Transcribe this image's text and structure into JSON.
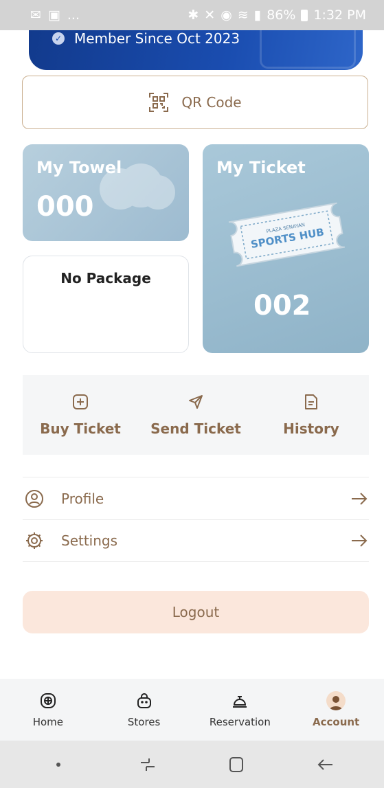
{
  "status_bar": {
    "battery": "86%",
    "time": "1:32 PM",
    "notif_overflow": "..."
  },
  "member_card": {
    "member_since": "Member Since Oct 2023"
  },
  "qr": {
    "label": "QR Code"
  },
  "towel": {
    "title": "My Towel",
    "count": "000"
  },
  "ticket": {
    "title": "My Ticket",
    "count": "002",
    "art_brand_small": "PLAZA SENAYAN",
    "art_brand": "SPORTS HUB"
  },
  "package": {
    "label": "No Package"
  },
  "actions": [
    {
      "label": "Buy Ticket",
      "icon": "plus-square-icon"
    },
    {
      "label": "Send Ticket",
      "icon": "send-icon"
    },
    {
      "label": "History",
      "icon": "document-icon"
    }
  ],
  "menu": [
    {
      "label": "Profile",
      "icon": "user-circle-icon"
    },
    {
      "label": "Settings",
      "icon": "gear-icon"
    }
  ],
  "logout": {
    "label": "Logout"
  },
  "bottom_nav": [
    {
      "label": "Home",
      "icon": "home-icon"
    },
    {
      "label": "Stores",
      "icon": "bag-icon"
    },
    {
      "label": "Reservation",
      "icon": "service-bell-icon"
    },
    {
      "label": "Account",
      "icon": "avatar-icon",
      "active": true
    }
  ],
  "colors": {
    "accent": "#8a6a4d",
    "card_blue": "#1a4db0",
    "tile_blue": "#9dbbd0",
    "logout_bg": "#fbe7dc"
  }
}
